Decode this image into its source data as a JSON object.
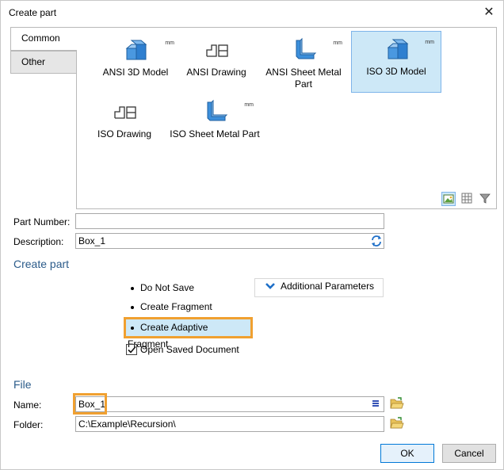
{
  "window": {
    "title": "Create part",
    "close_glyph": "✕"
  },
  "tabs": [
    {
      "label": "Common",
      "active": true
    },
    {
      "label": "Other",
      "active": false
    }
  ],
  "templates": [
    {
      "label": "ANSI 3D Model",
      "icon": "3d-model-icon",
      "unit": "mm",
      "selected": false
    },
    {
      "label": "ANSI Drawing",
      "icon": "drawing-icon",
      "unit": "",
      "selected": false
    },
    {
      "label": "ANSI Sheet Metal Part",
      "icon": "sheet-metal-icon",
      "unit": "mm",
      "selected": false
    },
    {
      "label": "ISO 3D Model",
      "icon": "3d-model-icon",
      "unit": "mm",
      "selected": true
    },
    {
      "label": "ISO Drawing",
      "icon": "drawing-icon",
      "unit": "",
      "selected": false
    },
    {
      "label": "ISO Sheet Metal Part",
      "icon": "sheet-metal-icon",
      "unit": "mm",
      "selected": false
    }
  ],
  "view_modes": [
    "large-icons-view-icon",
    "grid-view-icon",
    "filter-icon"
  ],
  "fields": {
    "part_number": {
      "label": "Part Number:",
      "value": ""
    },
    "description": {
      "label": "Description:",
      "value": "Box_1"
    }
  },
  "create_part": {
    "section_title": "Create part",
    "options": [
      {
        "label": "Do Not Save",
        "selected": false
      },
      {
        "label": "Create Fragment",
        "selected": false
      },
      {
        "label": "Create Adaptive Fragment",
        "selected": true
      }
    ],
    "additional_params_label": "Additional Parameters",
    "open_saved_document": {
      "label": "Open Saved Document",
      "checked": true
    }
  },
  "file": {
    "section_title": "File",
    "name": {
      "label": "Name:",
      "value": "Box_1"
    },
    "folder": {
      "label": "Folder:",
      "value": "C:\\Example\\Recursion\\"
    }
  },
  "buttons": {
    "ok": "OK",
    "cancel": "Cancel"
  },
  "colors": {
    "accent": "#0078d7",
    "selection_bg": "#cde8f7",
    "highlight_outline": "#f0a030",
    "section_title": "#2b5b8a",
    "icon_blue": "#3c8fdb"
  }
}
